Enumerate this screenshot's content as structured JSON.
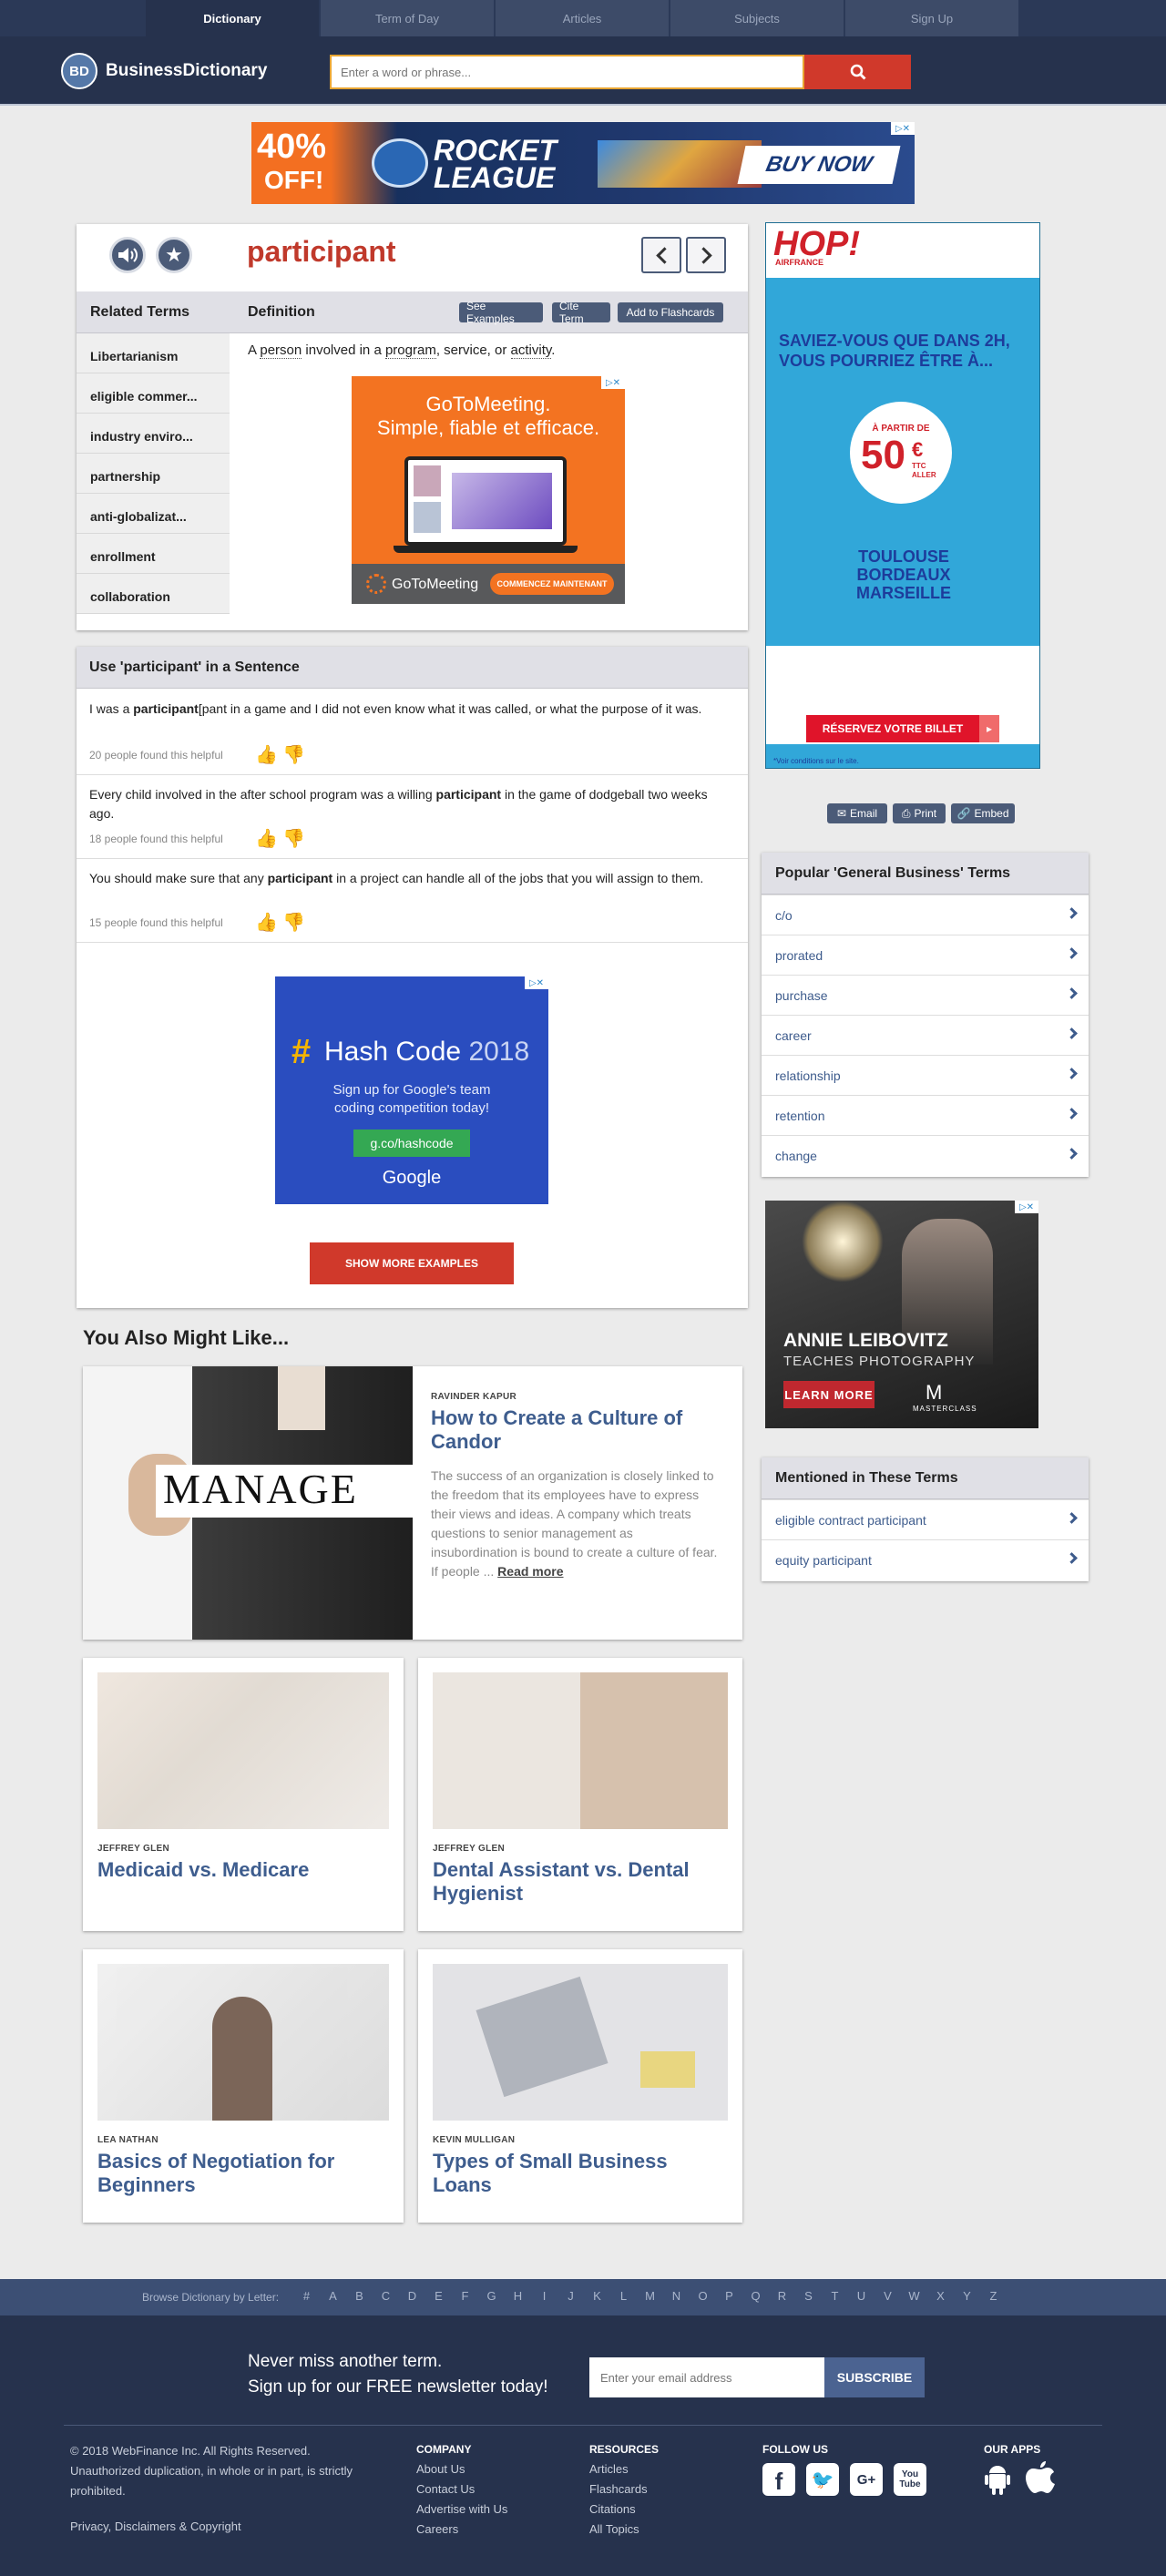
{
  "nav": {
    "tabs": [
      "Dictionary",
      "Term of Day",
      "Articles",
      "Subjects",
      "Sign Up"
    ]
  },
  "header": {
    "logo_badge": "BD",
    "logo_text": "BusinessDictionary",
    "search_placeholder": "Enter a word or phrase..."
  },
  "ads": {
    "top_banner": {
      "discount": "40%",
      "off": "OFF!",
      "brand_line1": "ROCKET",
      "brand_line2": "LEAGUE",
      "cta": "BUY NOW"
    },
    "gotomeeting": {
      "line1": "GoToMeeting.",
      "line2": "Simple, fiable et efficace.",
      "brand": "GoToMeeting",
      "cta": "COMMENCEZ MAINTENANT"
    },
    "hashcode": {
      "hash": "#",
      "title": "Hash Code",
      "year": "2018",
      "line1": "Sign up for Google's team",
      "line2": "coding competition today!",
      "link": "g.co/hashcode",
      "brand": "Google"
    },
    "hop": {
      "brand": "HOP!",
      "sub": "AIRFRANCE",
      "headline": "SAVIEZ-VOUS QUE DANS 2H, VOUS POURRIEZ ÊTRE À...",
      "badge_top": "À PARTIR DE",
      "price": "50",
      "currency": "€",
      "ttc": "TTC",
      "aller": "ALLER",
      "cities": [
        "TOULOUSE",
        "BORDEAUX",
        "MARSEILLE"
      ],
      "cta": "RÉSERVEZ VOTRE BILLET",
      "fine_print": "*Voir conditions sur le site."
    },
    "masterclass": {
      "name": "ANNIE LEIBOVITZ",
      "tagline": "TEACHES PHOTOGRAPHY",
      "cta": "LEARN MORE",
      "brand_mark": "M",
      "brand": "MASTERCLASS"
    }
  },
  "term": {
    "word": "participant",
    "related_heading": "Related Terms",
    "definition_heading": "Definition",
    "buttons": [
      "See Examples",
      "Cite Term",
      "Add to Flashcards"
    ],
    "related": [
      "Libertarianism",
      "eligible commer...",
      "industry enviro...",
      "partnership",
      "anti-globalizat...",
      "enrollment",
      "collaboration"
    ],
    "definition": {
      "a": "A ",
      "w1": "person",
      "b": " involved in a ",
      "w2": "program",
      "c": ", service, or ",
      "w3": "activity",
      "d": "."
    }
  },
  "sentences": {
    "heading": "Use 'participant' in a Sentence",
    "items": [
      {
        "pre": "I was a ",
        "bold": "participant",
        "post": "[pant in a game and I did not even know what it was called, or what the purpose of it was.",
        "helpful": "20 people found this helpful"
      },
      {
        "pre": "Every child involved in the after school program was a willing ",
        "bold": "participant",
        "post": " in the game of dodgeball two weeks ago.",
        "helpful": "18 people found this helpful"
      },
      {
        "pre": "You should make sure that any ",
        "bold": "participant",
        "post": " in a project can handle all of the jobs that you will assign to them.",
        "helpful": "15 people found this helpful"
      }
    ],
    "show_more": "SHOW MORE EXAMPLES"
  },
  "share": {
    "email": "Email",
    "print": "Print",
    "embed": "Embed"
  },
  "popular": {
    "heading": "Popular 'General Business' Terms",
    "items": [
      "c/o",
      "prorated",
      "purchase",
      "career",
      "relationship",
      "retention",
      "change"
    ]
  },
  "mentioned": {
    "heading": "Mentioned in These Terms",
    "items": [
      "eligible contract participant",
      "equity participant"
    ]
  },
  "also": {
    "heading": "You Also Might Like...",
    "featured": {
      "image_text": "MANAGE",
      "author": "RAVINDER KAPUR",
      "title": "How to Create a Culture of Candor",
      "excerpt": "The success of an organization is closely linked to the freedom that its employees have to express their views and ideas. A company which treats questions to senior management as insubordination is bound to create a culture of fear. If people ...",
      "read_more": "Read more"
    },
    "articles": [
      {
        "author": "JEFFREY GLEN",
        "title": "Medicaid vs. Medicare"
      },
      {
        "author": "JEFFREY GLEN",
        "title": "Dental Assistant vs. Dental Hygienist"
      },
      {
        "author": "LEA NATHAN",
        "title": "Basics of Negotiation for Beginners"
      },
      {
        "author": "KEVIN MULLIGAN",
        "title": "Types of Small Business Loans"
      }
    ]
  },
  "browse": {
    "label": "Browse Dictionary by Letter:",
    "letters": [
      "#",
      "A",
      "B",
      "C",
      "D",
      "E",
      "F",
      "G",
      "H",
      "I",
      "J",
      "K",
      "L",
      "M",
      "N",
      "O",
      "P",
      "Q",
      "R",
      "S",
      "T",
      "U",
      "V",
      "W",
      "X",
      "Y",
      "Z"
    ]
  },
  "newsletter": {
    "line1": "Never miss another term.",
    "line2": "Sign up for our FREE newsletter today!",
    "placeholder": "Enter your email address",
    "button": "SUBSCRIBE"
  },
  "footer": {
    "copyright": "© 2018 WebFinance Inc. All Rights Reserved.",
    "dup": "Unauthorized duplication, in whole or in part, is strictly prohibited.",
    "privacy": "Privacy, Disclaimers & Copyright",
    "company": {
      "heading": "COMPANY",
      "links": [
        "About Us",
        "Contact Us",
        "Advertise with Us",
        "Careers"
      ]
    },
    "resources": {
      "heading": "RESOURCES",
      "links": [
        "Articles",
        "Flashcards",
        "Citations",
        "All Topics"
      ]
    },
    "follow": {
      "heading": "FOLLOW US"
    },
    "apps": {
      "heading": "OUR APPS"
    }
  },
  "colors": {
    "brand_navy": "#26324d",
    "accent_red": "#d0392b",
    "link_blue": "#3d5b8c"
  }
}
